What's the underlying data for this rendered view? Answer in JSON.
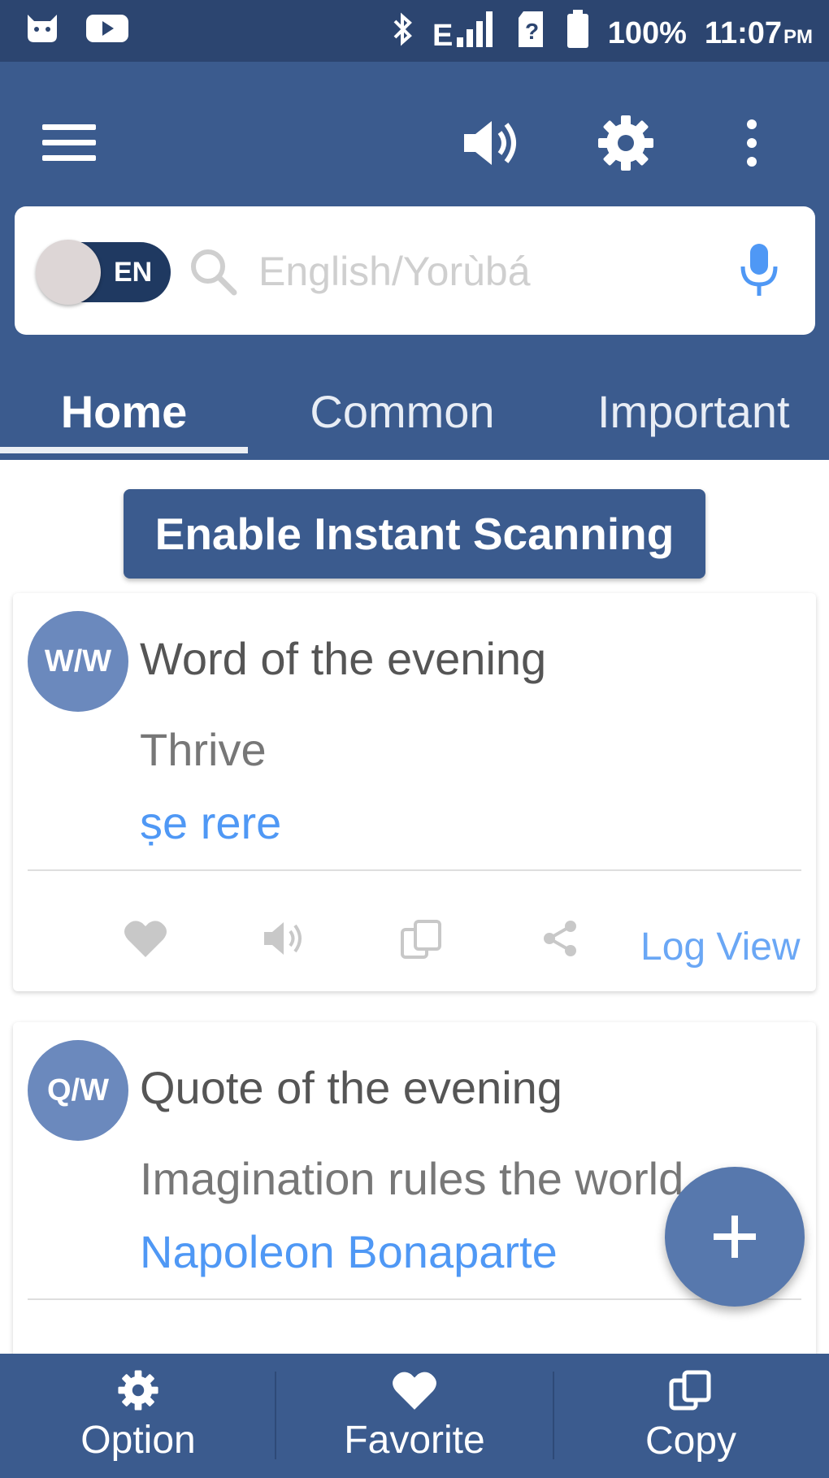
{
  "status_bar": {
    "battery": "100%",
    "time": "11:07",
    "ampm": "PM",
    "icons": [
      "cat-icon",
      "youtube-icon",
      "bluetooth-icon",
      "signal-icon",
      "sim-icon",
      "battery-icon"
    ]
  },
  "app_bar": {
    "icons": [
      "menu-icon",
      "speaker-icon",
      "gear-icon",
      "more-vert-icon"
    ]
  },
  "search": {
    "toggle_label": "EN",
    "placeholder": "English/Yorùbá"
  },
  "tabs": [
    {
      "label": "Home",
      "active": true
    },
    {
      "label": "Common",
      "active": false
    },
    {
      "label": "Important",
      "active": false
    }
  ],
  "scan_button": {
    "label": "Enable Instant Scanning"
  },
  "cards": [
    {
      "avatar": "W/W",
      "title": "Word of the evening",
      "text": "Thrive",
      "link": "ṣe rere",
      "action_link": "Log View"
    },
    {
      "avatar": "Q/W",
      "title": "Quote of the evening",
      "text": "Imagination rules the world.",
      "link": "Napoleon Bonaparte"
    }
  ],
  "fab": {
    "icon": "plus-icon"
  },
  "bottom_nav": [
    {
      "label": "Option",
      "icon": "gear-icon"
    },
    {
      "label": "Favorite",
      "icon": "heart-icon"
    },
    {
      "label": "Copy",
      "icon": "copy-icon"
    }
  ],
  "colors": {
    "primary": "#3b5b8e",
    "status_bar": "#2c4570",
    "avatar": "#6b89bd",
    "link": "#4f98f5",
    "fab": "#5778ad"
  }
}
